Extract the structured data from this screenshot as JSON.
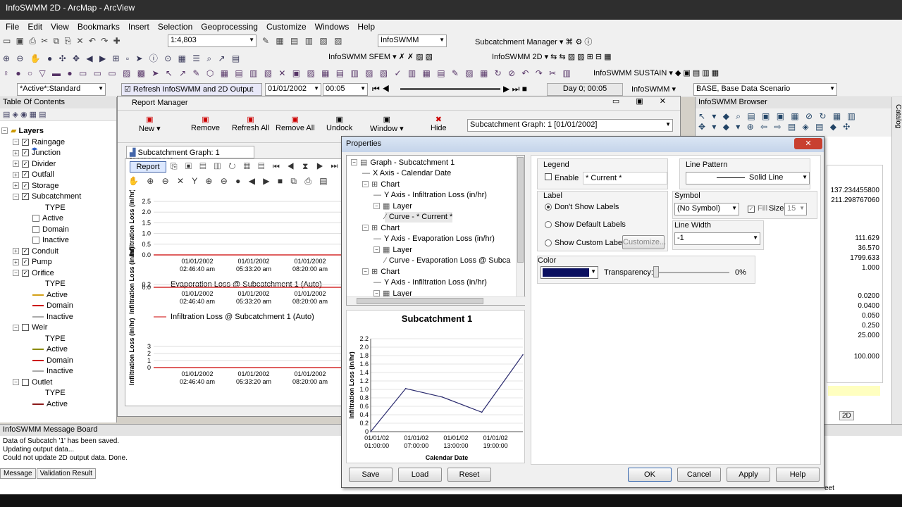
{
  "window": {
    "title": "InfoSWMM 2D - ArcMap - ArcView"
  },
  "menu": [
    "File",
    "Edit",
    "View",
    "Bookmarks",
    "Insert",
    "Selection",
    "Geoprocessing",
    "Customize",
    "Windows",
    "Help"
  ],
  "toolbar1": {
    "scale": "1:4,803",
    "infoswmm": "InfoSWMM",
    "subcatch_manager": "Subcatchment Manager"
  },
  "toolbar2": {
    "sfem": "InfoSWMM SFEM",
    "twod": "InfoSWMM 2D"
  },
  "toolbar3": {
    "sustain": "InfoSWMM SUSTAIN"
  },
  "toolbar4": {
    "standard": "*Active*:Standard",
    "refresh": "Refresh InfoSWMM and 2D Output",
    "date": "01/01/2002",
    "time": "00:05",
    "day": "Day 0;  00:05",
    "infoswmm": "InfoSWMM",
    "scenario": "BASE, Base Data Scenario"
  },
  "toc": {
    "title": "Table Of Contents",
    "layers": "Layers",
    "items": [
      {
        "label": "Raingage",
        "kind": "layer"
      },
      {
        "label": "Junction",
        "kind": "layer"
      },
      {
        "label": "Divider",
        "kind": "layer"
      },
      {
        "label": "Outfall",
        "kind": "layer"
      },
      {
        "label": "Storage",
        "kind": "layer"
      },
      {
        "label": "Subcatchment",
        "kind": "layer"
      },
      {
        "label": "TYPE",
        "kind": "sub"
      },
      {
        "label": "Active",
        "kind": "sub"
      },
      {
        "label": "Domain",
        "kind": "sub"
      },
      {
        "label": "Inactive",
        "kind": "sub"
      },
      {
        "label": "Conduit",
        "kind": "layer"
      },
      {
        "label": "Pump",
        "kind": "layer"
      },
      {
        "label": "Orifice",
        "kind": "layer"
      },
      {
        "label": "TYPE",
        "kind": "sub"
      },
      {
        "label": "Active",
        "kind": "sub"
      },
      {
        "label": "Domain",
        "kind": "sub"
      },
      {
        "label": "Inactive",
        "kind": "sub"
      },
      {
        "label": "Weir",
        "kind": "layer"
      },
      {
        "label": "TYPE",
        "kind": "sub"
      },
      {
        "label": "Active",
        "kind": "sub"
      },
      {
        "label": "Domain",
        "kind": "sub"
      },
      {
        "label": "Inactive",
        "kind": "sub"
      },
      {
        "label": "Outlet",
        "kind": "layer"
      },
      {
        "label": "TYPE",
        "kind": "sub"
      },
      {
        "label": "Active",
        "kind": "sub"
      }
    ]
  },
  "report_manager": {
    "title": "Report Manager",
    "new": "New",
    "remove": "Remove",
    "refresh_all": "Refresh All",
    "remove_all": "Remove All",
    "undock": "Undock",
    "window": "Window",
    "hide": "Hide",
    "graph_select": "Subcatchment Graph: 1 [01/01/2002]",
    "tab": "Subcatchment Graph: 1 [01/01/2002]",
    "report_btn": "Report",
    "graphs": [
      {
        "ylabel": "Infiltration Loss (in/hr)",
        "ticks": [
          "2.5",
          "2.0",
          "1.5",
          "1.0",
          "0.5",
          "0.0"
        ],
        "x": [
          "01/01/2002\n02:46:40 am",
          "01/01/2002\n05:33:20 am",
          "01/01/2002\n08:20:00 am"
        ],
        "legend": "Evaporation Loss @ Subcatchment 1 (Auto)"
      },
      {
        "ylabel": "Infiltration Loss (in/hr)",
        "ticks": [
          "0.2",
          "0.0"
        ],
        "x": [
          "01/01/2002\n02:46:40 am",
          "01/01/2002\n05:33:20 am",
          "01/01/2002\n08:20:00 am"
        ],
        "legend": "Infiltration Loss @ Subcatchment 1 (Auto)"
      },
      {
        "ylabel": "Infiltration Loss (in/hr)",
        "ticks": [
          "3",
          "2",
          "1",
          "0"
        ],
        "x": [
          "01/01/2002\n02:46:40 am",
          "01/01/2002\n05:33:20 am",
          "01/01/2002\n08:20:00 am"
        ],
        "legend": ""
      }
    ]
  },
  "properties": {
    "title": "Properties",
    "tree": [
      "Graph - Subcatchment 1",
      "X Axis - Calendar Date",
      "Chart",
      "Y Axis - Infiltration Loss (in/hr)",
      "Layer",
      "Curve - * Current *",
      "Chart",
      "Y Axis - Evaporation Loss (in/hr)",
      "Layer",
      "Curve - Evaporation Loss @ Subca",
      "Chart",
      "Y Axis - Infiltration Loss (in/hr)",
      "Layer"
    ],
    "legend": {
      "title": "Legend",
      "enable": "Enable",
      "value": "* Current *"
    },
    "line_pattern": {
      "title": "Line Pattern",
      "value": "Solid Line"
    },
    "label": {
      "title": "Label",
      "opt1": "Don't Show Labels",
      "opt2": "Show Default Labels",
      "opt3": "Show Custom Labels",
      "customize": "Customize..."
    },
    "symbol": {
      "title": "Symbol",
      "value": "(No Symbol)",
      "fill": "Fill",
      "size_label": "Size",
      "size": "15"
    },
    "line_width": {
      "title": "Line Width",
      "value": "-1"
    },
    "color": {
      "title": "Color",
      "transparency": "Transparency:",
      "pct": "0%",
      "swatch": "#0b1060"
    },
    "buttons": {
      "save": "Save",
      "load": "Load",
      "reset": "Reset",
      "ok": "OK",
      "cancel": "Cancel",
      "apply": "Apply",
      "help": "Help"
    }
  },
  "chart_data": {
    "type": "line",
    "title": "Subcatchment 1",
    "xlabel": "Calendar Date",
    "ylabel": "Infiltration Loss (in/hr)",
    "ylim": [
      0,
      2.2
    ],
    "yticks": [
      "0",
      "0.2",
      "0.4",
      "0.6",
      "0.8",
      "1.0",
      "1.2",
      "1.4",
      "1.6",
      "1.8",
      "2.0",
      "2.2"
    ],
    "xticks": [
      "01/01/02\n01:00:00",
      "01/01/02\n07:00:00",
      "01/01/02\n13:00:00",
      "01/01/02\n19:00:00"
    ],
    "x": [
      0,
      0.23,
      0.47,
      0.73,
      1.0
    ],
    "values": [
      0.0,
      1.02,
      0.82,
      0.46,
      1.82
    ],
    "color": "#2a2a6e"
  },
  "browser": {
    "title": "InfoSWMM Browser",
    "values": [
      "137.234455800",
      "211.298767060",
      "111.629",
      "36.570",
      "1799.633",
      "1.000",
      "0.0200",
      "0.0400",
      "0.050",
      "0.250",
      "25.000",
      "100.000"
    ],
    "tab2d": "2D",
    "catalog": "Catalog"
  },
  "message_board": {
    "title": "InfoSWMM Message Board",
    "lines": [
      "Data of Subcatch '1' has been saved.",
      "Updating output data...",
      "Could not update 2D output data. Done."
    ],
    "tab_message": "Message",
    "tab_validation": "Validation Result"
  },
  "bottom_right": "eet"
}
